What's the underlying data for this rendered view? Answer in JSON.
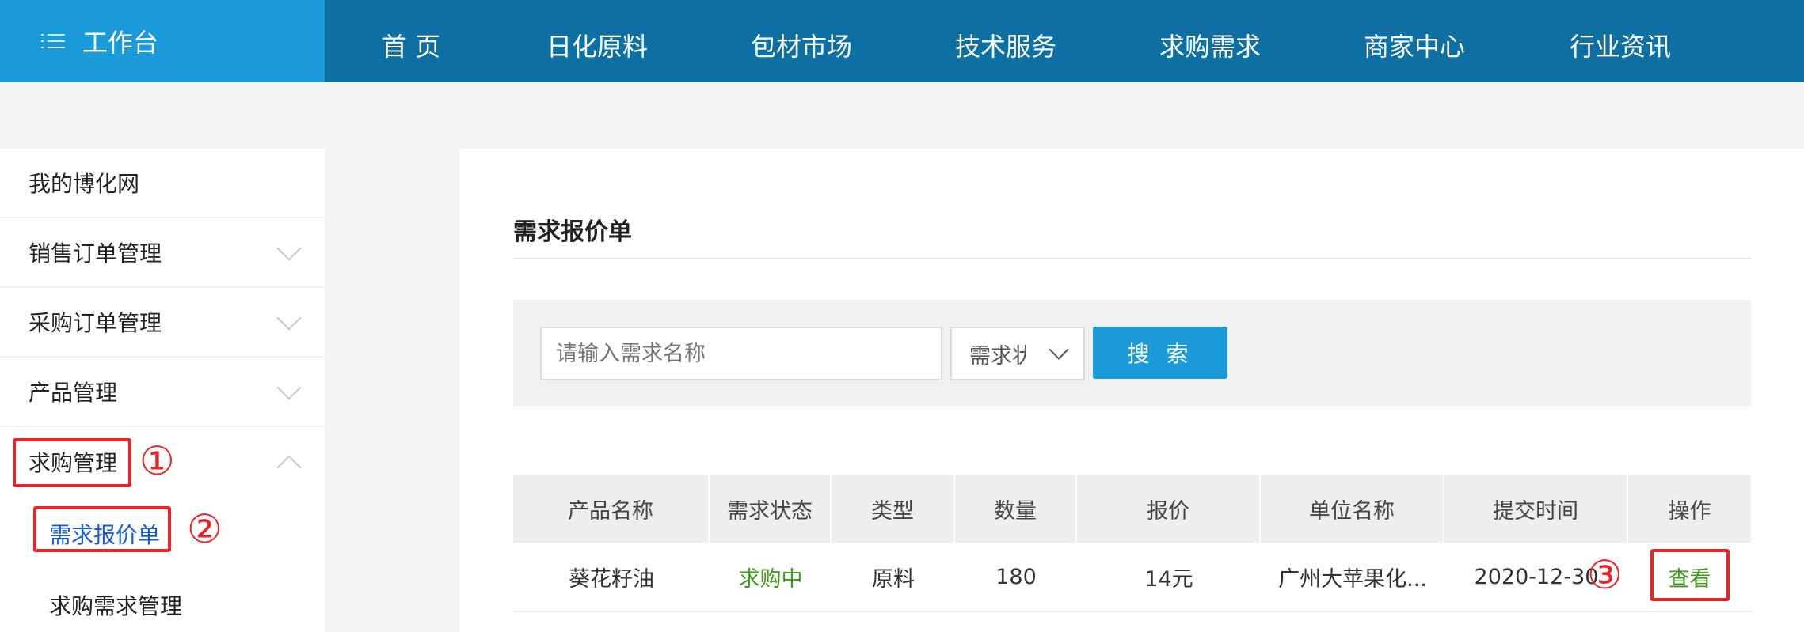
{
  "topnav": {
    "workbench_label": "工作台",
    "items": [
      "首 页",
      "日化原料",
      "包材市场",
      "技术服务",
      "求购需求",
      "商家中心",
      "行业资讯"
    ]
  },
  "sidebar": {
    "items": [
      {
        "label": "我的博化网"
      },
      {
        "label": "销售订单管理"
      },
      {
        "label": "采购订单管理"
      },
      {
        "label": "产品管理"
      },
      {
        "label": "求购管理"
      }
    ],
    "subitems": [
      {
        "label": "需求报价单",
        "active": true
      },
      {
        "label": "求购需求管理"
      }
    ]
  },
  "annotations": {
    "step1": "①",
    "step2": "②",
    "step3": "③"
  },
  "main": {
    "title": "需求报价单",
    "search": {
      "placeholder": "请输入需求名称",
      "status_value": "需求状态",
      "button_label": "搜 索"
    },
    "table": {
      "headers": [
        "产品名称",
        "需求状态",
        "类型",
        "数量",
        "报价",
        "单位名称",
        "提交时间",
        "操作"
      ],
      "rows": [
        [
          "葵花籽油",
          "求购中",
          "原料",
          "180",
          "14元",
          "广州大苹果化...",
          "2020-12-30",
          "查看"
        ]
      ]
    }
  },
  "colors": {
    "nav_bg": "#0e6fa3",
    "workbench_bg": "#1a9ad8",
    "accent_blue": "#1a9ad8",
    "active_link": "#1a5bd8",
    "status_green": "#3f9a1e",
    "annotation_red": "#e8262a"
  }
}
